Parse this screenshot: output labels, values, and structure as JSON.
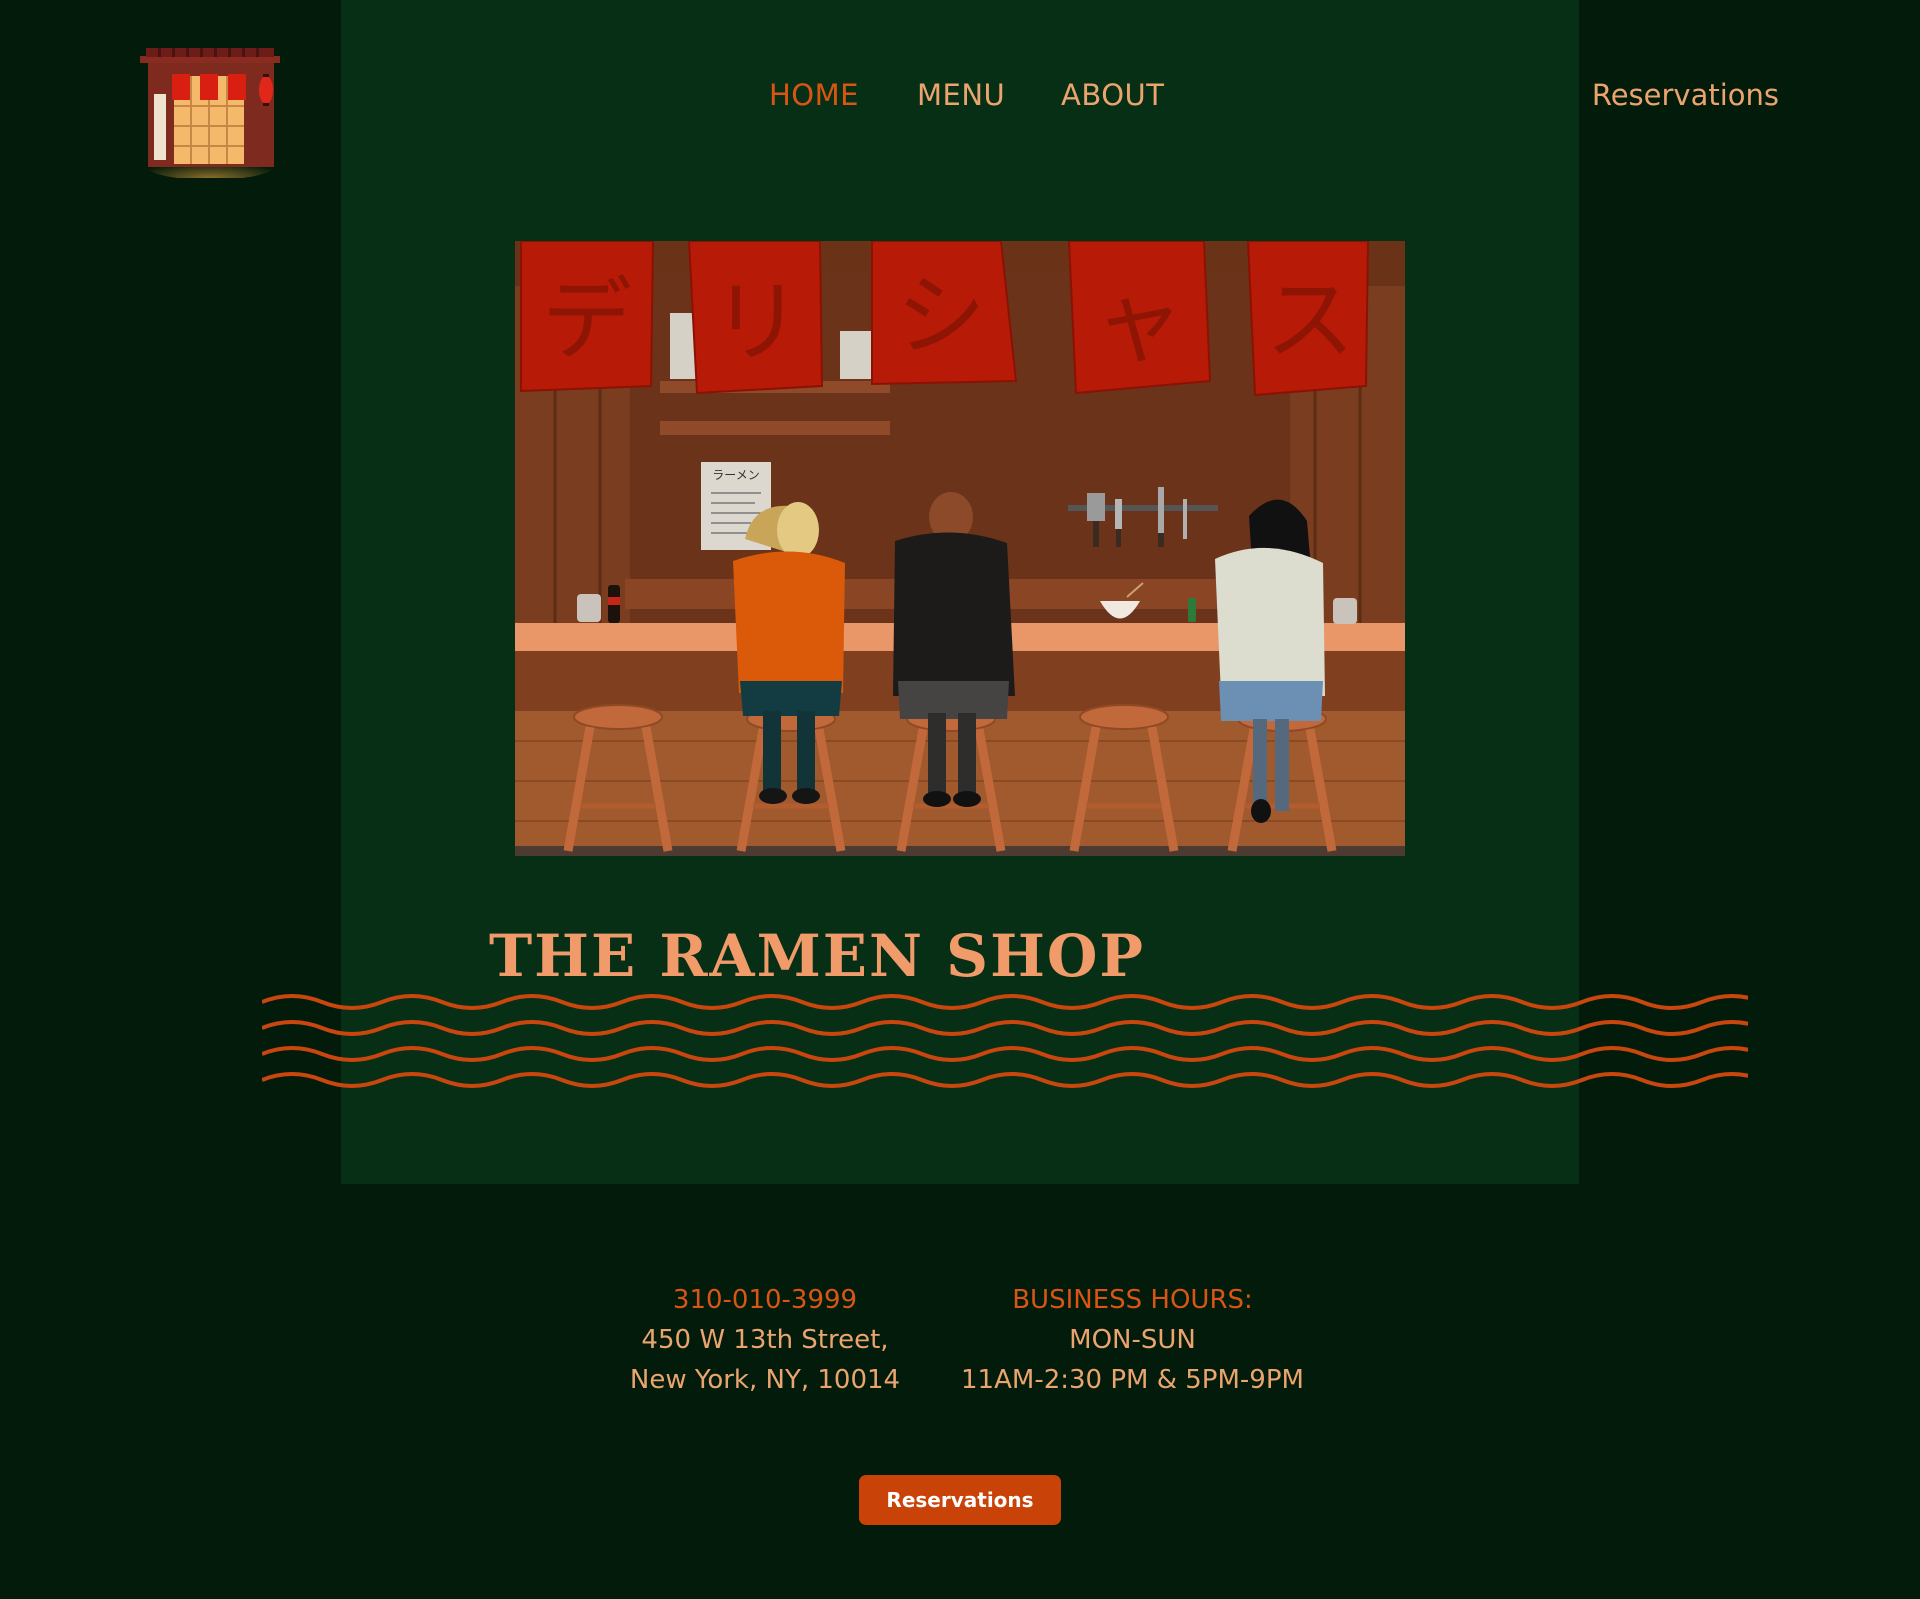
{
  "nav": {
    "items": [
      {
        "label": "HOME",
        "active": true
      },
      {
        "label": "MENU",
        "active": false
      },
      {
        "label": "ABOUT",
        "active": false
      }
    ],
    "reservations_label": "Reservations"
  },
  "hero": {
    "banner_characters": [
      "デ",
      "リ",
      "シ",
      "ャ",
      "ス"
    ],
    "menu_sign_text": "ラーメン"
  },
  "site": {
    "title": "THE RAMEN SHOP"
  },
  "contact": {
    "phone": "310-010-3999",
    "address_line1": "450 W 13th Street,",
    "address_line2": "New York, NY, 10014"
  },
  "hours": {
    "heading": "BUSINESS HOURS:",
    "days": "MON-SUN",
    "times": "11AM-2:30 PM & 5PM-9PM"
  },
  "cta": {
    "label": "Reservations"
  },
  "colors": {
    "background": "#021b0a",
    "panel": "#072f15",
    "accent": "#d95514",
    "text": "#eba46e",
    "button": "#c94308"
  }
}
